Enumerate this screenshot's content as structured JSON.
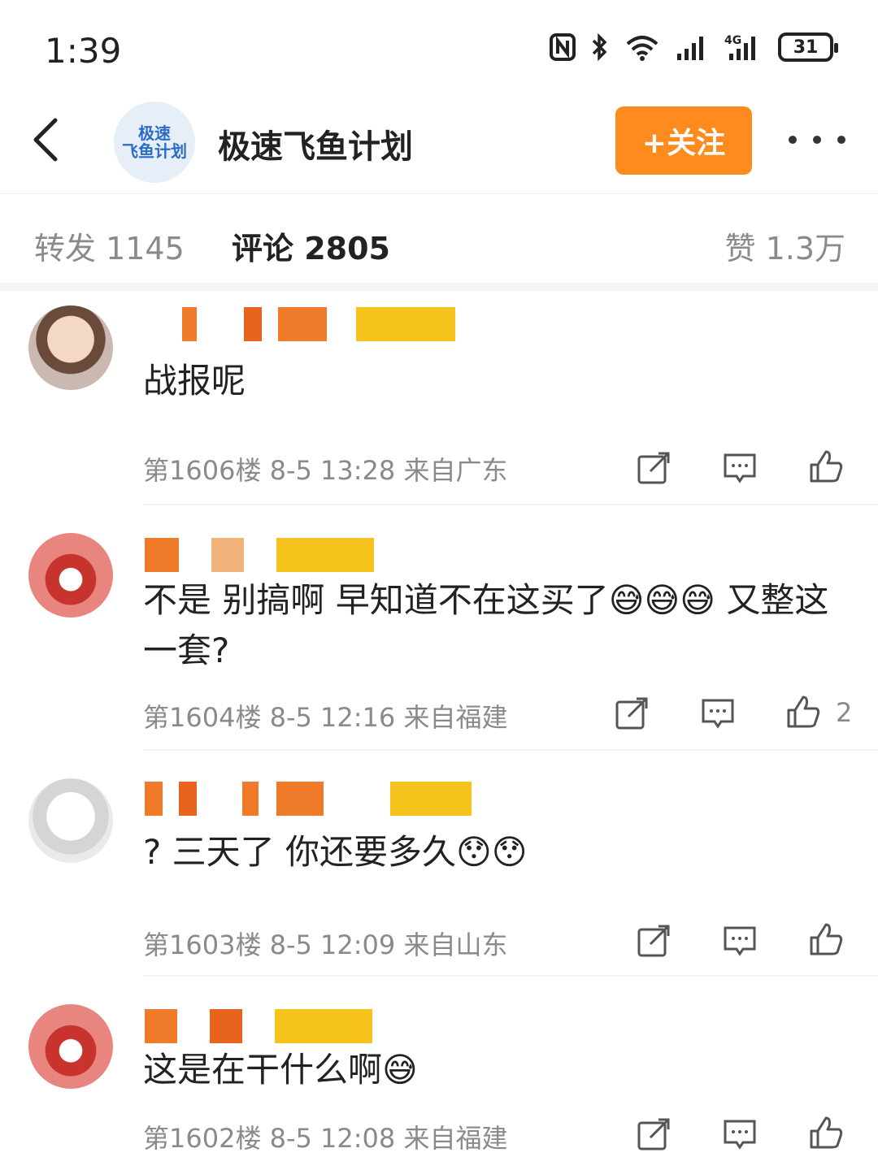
{
  "status_bar": {
    "time": "1:39",
    "battery": "31"
  },
  "header": {
    "account_name": "极速飞鱼计划",
    "avatar_text_line1": "极速",
    "avatar_text_line2": "飞鱼计划",
    "follow_label": "+关注"
  },
  "tabs": [
    {
      "label": "转发 1145"
    },
    {
      "label": "评论 2805"
    },
    {
      "label": "赞 1.3万"
    }
  ],
  "comments": [
    {
      "text": "战报呢",
      "meta": "第1606楼 8-5 13:28 来自广东",
      "likes": ""
    },
    {
      "text": "不是 别搞啊 早知道不在这买了😅😅😅 又整这一套?",
      "meta": "第1604楼 8-5 12:16 来自福建",
      "likes": "2"
    },
    {
      "text": "? 三天了 你还要多久😯😯",
      "meta": "第1603楼 8-5 12:09 来自山东",
      "likes": ""
    },
    {
      "text": "这是在干什么啊😅",
      "meta": "第1602楼 8-5 12:08 来自福建",
      "likes": ""
    }
  ],
  "colors": {
    "accent": "#ff8a1e",
    "muted": "#8a8a8a"
  },
  "icons": [
    "back-arrow-icon",
    "more-icon",
    "share-icon",
    "comment-icon",
    "like-icon"
  ]
}
